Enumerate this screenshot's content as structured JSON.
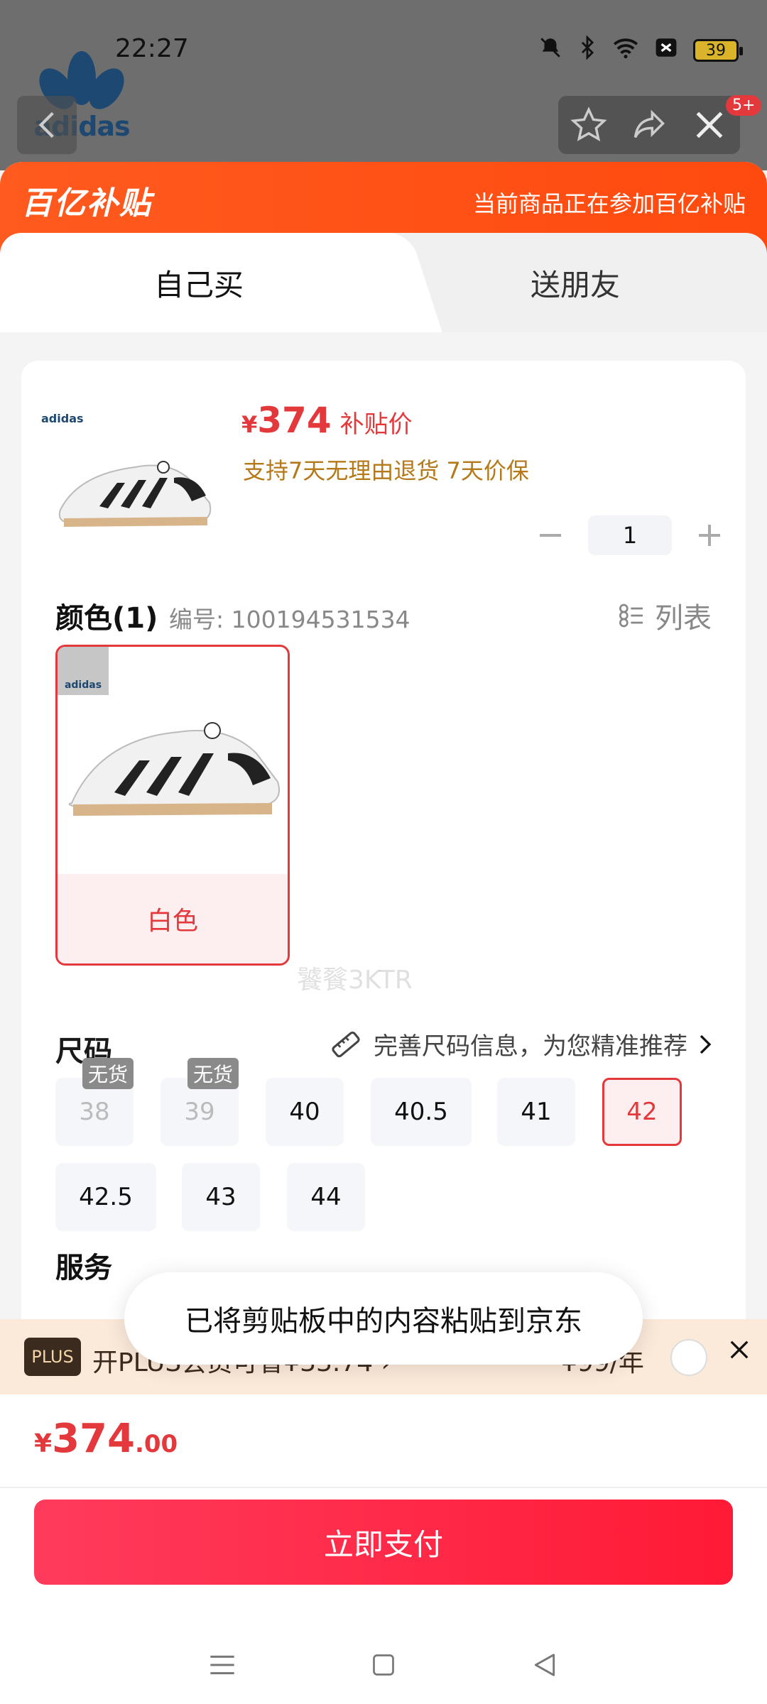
{
  "status_bar": {
    "time": "22:27",
    "battery": "39"
  },
  "background": {
    "brand_word": "adidas",
    "badge": "5+"
  },
  "promo": {
    "logo_text": "百亿补贴",
    "text": "当前商品正在参加百亿补贴"
  },
  "tabs": [
    {
      "label": "自己买"
    },
    {
      "label": "送朋友"
    }
  ],
  "product": {
    "mini_brand": "adidas",
    "currency": "¥",
    "price": "374",
    "price_tag": "补贴价",
    "service": "支持7天无理由退货  7天价保",
    "quantity": "1"
  },
  "color": {
    "title": "颜色(1)",
    "item_number": "编号: 100194531534",
    "list_toggle": "列表",
    "options": [
      {
        "label": "白色",
        "brand": "adidas"
      }
    ]
  },
  "size": {
    "title": "尺码",
    "tip": "完善尺码信息，为您精准推荐",
    "soldout_label": "无货",
    "options": [
      {
        "label": "38",
        "state": "soldout"
      },
      {
        "label": "39",
        "state": "soldout"
      },
      {
        "label": "40",
        "state": "available"
      },
      {
        "label": "40.5",
        "state": "available"
      },
      {
        "label": "41",
        "state": "available"
      },
      {
        "label": "42",
        "state": "selected"
      },
      {
        "label": "42.5",
        "state": "available"
      },
      {
        "label": "43",
        "state": "available"
      },
      {
        "label": "44",
        "state": "available"
      }
    ]
  },
  "service_peek": "服务",
  "watermark": "饕餮3KTR",
  "toast": "已将剪贴板中的内容粘贴到京东",
  "plus": {
    "badge": "PLUS",
    "text": "开PLUS会员可省¥33.74 ›",
    "price": "¥99/年"
  },
  "footer": {
    "currency": "¥",
    "price_int": "374",
    "price_dec": ".00",
    "pay_label": "立即支付"
  },
  "colors": {
    "accent": "#e4393c",
    "promo": "#ff5a1f",
    "pay_button": "#ff2a45"
  }
}
